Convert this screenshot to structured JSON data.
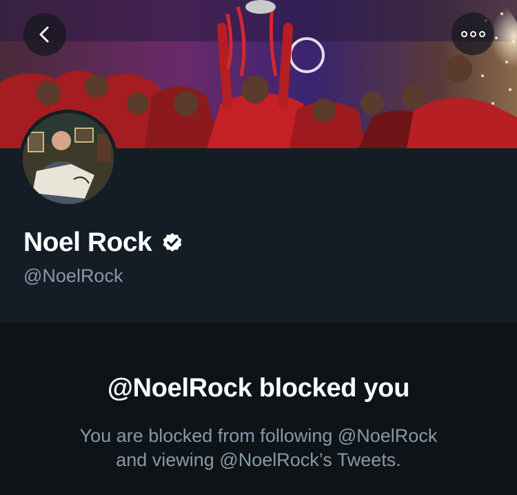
{
  "header": {
    "back_icon": "chevron-left-icon",
    "more_icon": "more-options-icon"
  },
  "profile": {
    "display_name": "Noel Rock",
    "verified_icon": "verified-badge-icon",
    "handle": "@NoelRock"
  },
  "blocked": {
    "title": "@NoelRock blocked you",
    "description_line1": "You are blocked from following @NoelRock",
    "description_line2": "and viewing @NoelRock’s Tweets."
  },
  "colors": {
    "background": "#141c26",
    "blocked_background": "#0e1318",
    "primary_text": "#ffffff",
    "secondary_text": "#8899a6"
  }
}
